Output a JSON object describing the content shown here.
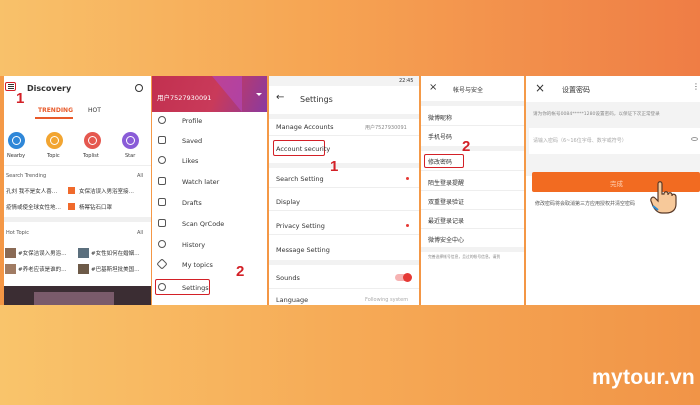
{
  "marks": {
    "m1a": "1",
    "m2a": "2",
    "m1b": "1",
    "m2b": "2"
  },
  "p1": {
    "title": "Discovery",
    "tab_trending": "TRENDING",
    "tab_hot": "HOT",
    "icons": [
      {
        "label": "Nearby",
        "color": "#2f87d8"
      },
      {
        "label": "Topic",
        "color": "#f2a531"
      },
      {
        "label": "Toplist",
        "color": "#e5584f"
      },
      {
        "label": "Star",
        "color": "#8a5cd8"
      }
    ],
    "search_trending": "Search Trending",
    "all": "All",
    "trend": [
      "孔刘 我不是女人喜…",
      "女保洁误入男浴室接…",
      "疫情或使全球女性地…",
      "杨幂钻石口罩"
    ],
    "hot_topic": "Hot Topic",
    "hot": [
      "#女保洁误入男浴…",
      "#女性如何在婚姻…",
      "#养老应该是谁的…",
      "#巴基斯坦批美国…"
    ]
  },
  "p2": {
    "user": "用户7527930091",
    "items": [
      "Profile",
      "Saved",
      "Likes",
      "Watch later",
      "Drafts",
      "Scan QrCode",
      "History",
      "My topics",
      "Settings"
    ]
  },
  "p3": {
    "time": "22:45",
    "title": "Settings",
    "manage": "Manage Accounts",
    "manage_value": "用户7527930091",
    "items": [
      "Account security",
      "Search Setting",
      "Display",
      "Privacy Setting",
      "Message Setting",
      "Sounds",
      "Language"
    ],
    "language_value": "Following system"
  },
  "p4": {
    "title": "帐号与安全",
    "items": [
      "微博昵称",
      "手机号码",
      "修改密码",
      "陌生登录提醒",
      "双重登录验证",
      "最近登录记录",
      "微博安全中心"
    ],
    "footnote": "完善选择帐号信息，且过的帐号信息，请到"
  },
  "p5": {
    "title": "设置密码",
    "desc": "请为你的帐号0084*****1280设置密码，以保证下次正常登录",
    "placeholder": "请输入密码（6~16位字母、数字或符号）",
    "button": "完成",
    "note": "修改密码将会取消第三方应用授权并清空密码"
  },
  "logo": "mytour.vn",
  "colors": {
    "accent": "#f26b21",
    "highlight": "#d32027"
  }
}
